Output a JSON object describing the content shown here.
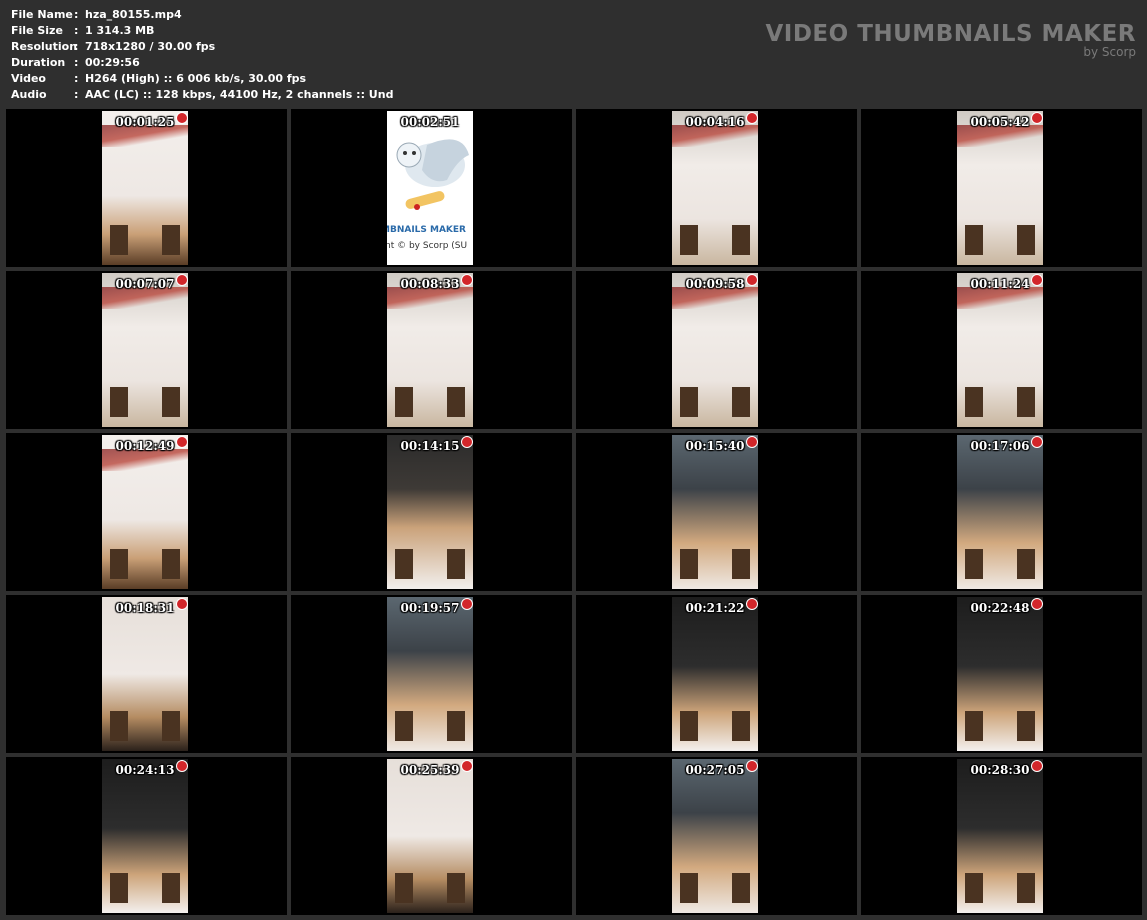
{
  "file_info": [
    {
      "key": "File Name",
      "value": "hza_80155.mp4"
    },
    {
      "key": "File Size",
      "value": "1 314.3 MB"
    },
    {
      "key": "Resolution",
      "value": "718x1280 / 30.00 fps"
    },
    {
      "key": "Duration",
      "value": "00:29:56"
    },
    {
      "key": "Video",
      "value": "H264 (High) :: 6 006 kb/s, 30.00 fps"
    },
    {
      "key": "Audio",
      "value": "AAC (LC) :: 128 kbps, 44100 Hz, 2 channels :: Und"
    }
  ],
  "separator": ":",
  "brand": {
    "title": "VIDEO THUMBNAILS MAKER",
    "subtitle": "by Scorp"
  },
  "logo_text": {
    "line1": "MBNAILS MAKER",
    "line2": "nt © by Scorp (SU"
  },
  "thumbnails": [
    {
      "time": "00:01:25",
      "scene": "scene-a"
    },
    {
      "time": "00:02:51",
      "scene": "logo"
    },
    {
      "time": "00:04:16",
      "scene": "scene-b"
    },
    {
      "time": "00:05:42",
      "scene": "scene-b"
    },
    {
      "time": "00:07:07",
      "scene": "scene-b"
    },
    {
      "time": "00:08:33",
      "scene": "scene-b"
    },
    {
      "time": "00:09:58",
      "scene": "scene-b"
    },
    {
      "time": "00:11:24",
      "scene": "scene-b"
    },
    {
      "time": "00:12:49",
      "scene": "scene-a"
    },
    {
      "time": "00:14:15",
      "scene": "scene-c"
    },
    {
      "time": "00:15:40",
      "scene": "scene-d"
    },
    {
      "time": "00:17:06",
      "scene": "scene-d"
    },
    {
      "time": "00:18:31",
      "scene": "scene-f"
    },
    {
      "time": "00:19:57",
      "scene": "scene-d"
    },
    {
      "time": "00:21:22",
      "scene": "scene-e"
    },
    {
      "time": "00:22:48",
      "scene": "scene-e"
    },
    {
      "time": "00:24:13",
      "scene": "scene-e"
    },
    {
      "time": "00:25:39",
      "scene": "scene-f"
    },
    {
      "time": "00:27:05",
      "scene": "scene-d"
    },
    {
      "time": "00:28:30",
      "scene": "scene-e"
    }
  ]
}
